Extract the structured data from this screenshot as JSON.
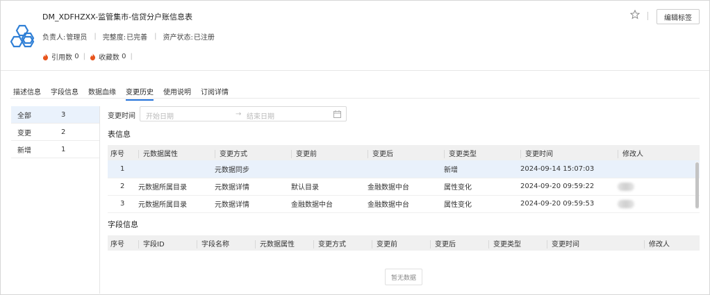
{
  "header": {
    "title": "DM_XDFHZXX-监管集市-信贷分户账信息表",
    "owner_label": "负责人:",
    "owner": "管理员",
    "completeness_label": "完整度:",
    "completeness": "已完善",
    "asset_status_label": "资产状态:",
    "asset_status": "已注册",
    "cite_label": "引用数",
    "cite_count": "0",
    "fav_label": "收藏数",
    "fav_count": "0",
    "edit_tags": "编辑标签",
    "colors": {
      "fire": "#e8541c",
      "logo": "#2f7fd6",
      "accent": "#1e6fd9"
    }
  },
  "tabs": [
    {
      "label": "描述信息"
    },
    {
      "label": "字段信息"
    },
    {
      "label": "数据血缘"
    },
    {
      "label": "变更历史",
      "active": true
    },
    {
      "label": "使用说明"
    },
    {
      "label": "订阅详情"
    }
  ],
  "side": [
    {
      "label": "全部",
      "count": "3",
      "active": true
    },
    {
      "label": "变更",
      "count": "2"
    },
    {
      "label": "新增",
      "count": "1"
    }
  ],
  "filter": {
    "label": "变更时间",
    "start_placeholder": "开始日期",
    "arrow": "→",
    "end_placeholder": "结束日期"
  },
  "table_info": {
    "title": "表信息",
    "columns": [
      "序号",
      "元数据属性",
      "变更方式",
      "变更前",
      "变更后",
      "变更类型",
      "变更时间",
      "修改人"
    ],
    "rows": [
      [
        "1",
        "",
        "元数据同步",
        "",
        "",
        "新增",
        "2024-09-14 15:07:03",
        ""
      ],
      [
        "2",
        "元数据所属目录",
        "元数据详情",
        "默认目录",
        "金融数据中台",
        "属性变化",
        "2024-09-20 09:59:22",
        ""
      ],
      [
        "3",
        "元数据所属目录",
        "元数据详情",
        "金融数据中台",
        "金融数据中台",
        "属性变化",
        "2024-09-20 09:59:53",
        ""
      ]
    ]
  },
  "field_info": {
    "title": "字段信息",
    "columns": [
      "序号",
      "字段ID",
      "字段名称",
      "元数据属性",
      "变更方式",
      "变更前",
      "变更后",
      "变更类型",
      "变更时间",
      "修改人"
    ],
    "empty_text": "暂无数据"
  }
}
